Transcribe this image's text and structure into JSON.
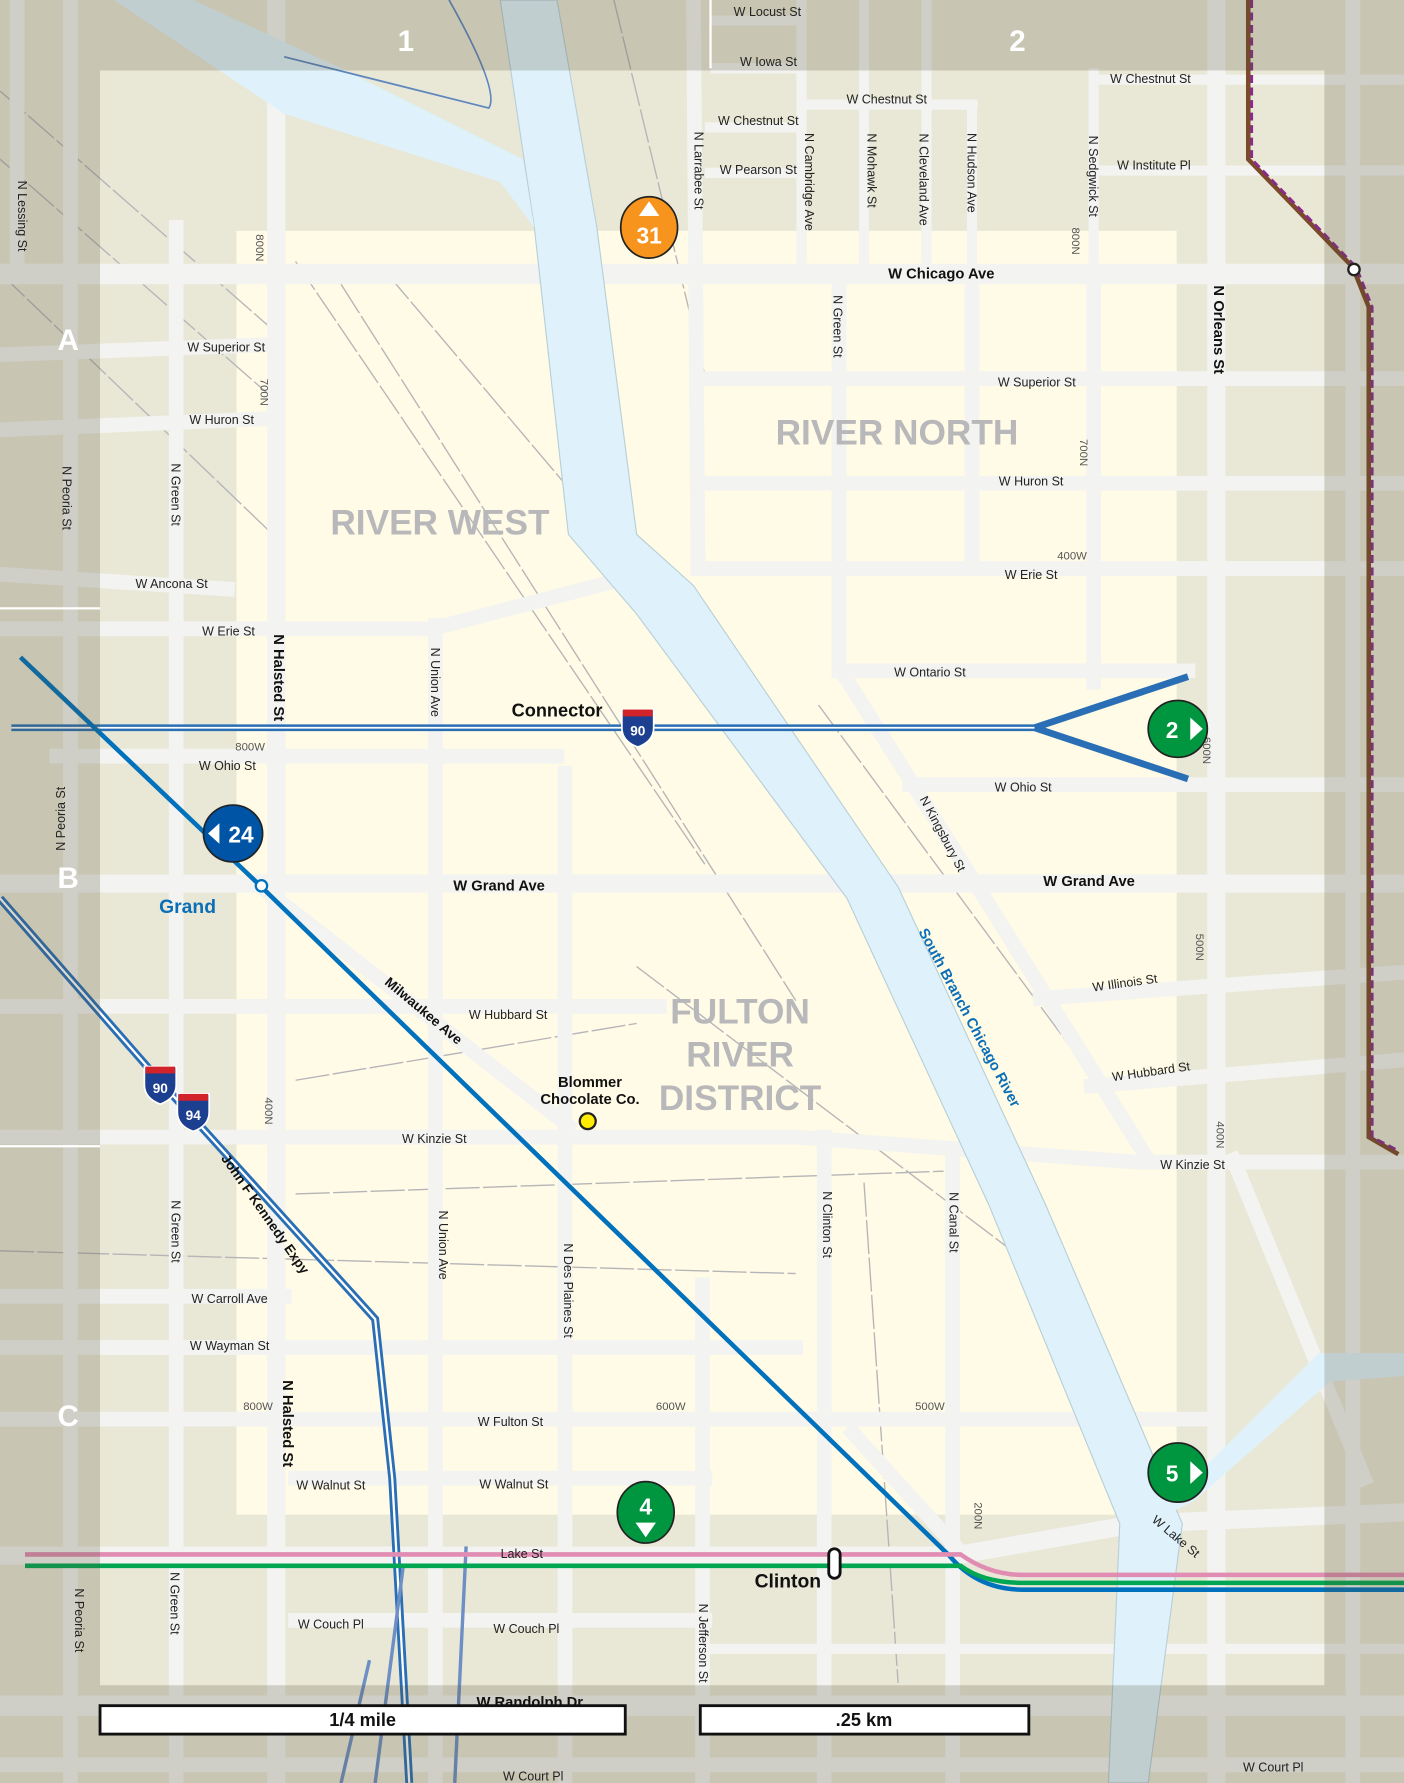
{
  "grid": {
    "columns": [
      "1",
      "2"
    ],
    "rows": [
      "A",
      "B",
      "C"
    ]
  },
  "neighborhoods": {
    "river_west": "RIVER WEST",
    "river_north": "RIVER NORTH",
    "fulton": [
      "FULTON",
      "RIVER",
      "DISTRICT"
    ]
  },
  "streets": [
    "W Locust St",
    "W Iowa St",
    "W Chestnut St",
    "W Chestnut St",
    "W Chestnut St",
    "W Pearson St",
    "W Institute Pl",
    "W Chicago Ave",
    "W Superior St",
    "W Superior St",
    "W Huron St",
    "W Huron St",
    "W Ancona St",
    "W Erie St",
    "W Erie St",
    "W Ontario St",
    "W Ohio St",
    "W Ohio St",
    "W Grand Ave",
    "W Grand Ave",
    "W Hubbard St",
    "W Hubbard St",
    "W Illinois St",
    "W Kinzie St",
    "W Kinzie St",
    "W Carroll Ave",
    "W Wayman St",
    "W Fulton St",
    "W Walnut St",
    "W Walnut St",
    "Lake St",
    "W Lake St",
    "W Couch Pl",
    "W Couch Pl",
    "W Randolph Dr",
    "W Court Pl",
    "W Court Pl",
    "N Lessing St",
    "N Peoria St",
    "N Green St",
    "N Larrabee St",
    "N Cambridge Ave",
    "N Mohawk St",
    "N Cleveland Ave",
    "N Hudson Ave",
    "N Sedgwick St",
    "N Green St",
    "N Orleans St",
    "N Halsted St",
    "N Union Ave",
    "N Kingsbury St",
    "N Peoria St",
    "N Green St",
    "N Union Ave",
    "N Des Plaines St",
    "N Clinton St",
    "N Canal St",
    "N Halsted St",
    "N Peoria St",
    "N Green St",
    "N Jefferson St",
    "Milwaukee Ave",
    "John F Kennedy Expy"
  ],
  "hundred_blocks": [
    "800N",
    "800N",
    "700N",
    "700N",
    "400W",
    "800W",
    "600N",
    "500N",
    "400N",
    "400N",
    "800W",
    "600W",
    "500W",
    "200N"
  ],
  "highways": {
    "connector": "Connector",
    "i90": "90",
    "i94": "94"
  },
  "river": "South Branch Chicago River",
  "stations": {
    "grand": "Grand",
    "clinton": "Clinton"
  },
  "landmark": [
    "Blommer",
    "Chocolate Co."
  ],
  "markers": [
    {
      "number": "31",
      "direction": "up",
      "color": "#f7941d"
    },
    {
      "number": "24",
      "direction": "left",
      "color": "#0054a6"
    },
    {
      "number": "2",
      "direction": "right",
      "color": "#00963f"
    },
    {
      "number": "4",
      "direction": "down",
      "color": "#00963f"
    },
    {
      "number": "5",
      "direction": "right",
      "color": "#00963f"
    }
  ],
  "scale": {
    "miles": "1/4 mile",
    "km": ".25 km"
  },
  "colors": {
    "blue_line": "#0071bc",
    "pink_line": "#e18db3",
    "green_line": "#00a651",
    "brown_line": "#7b4a2a",
    "purple_line": "#8a2a8c",
    "river": "#dff2fb"
  }
}
